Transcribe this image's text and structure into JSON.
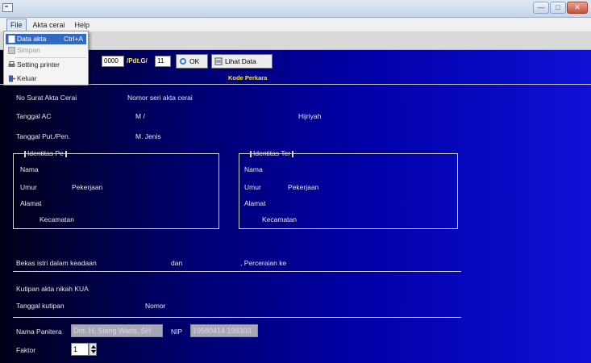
{
  "menubar": {
    "file": "File",
    "akta": "Akta cerai",
    "help": "Help"
  },
  "window_buttons": {
    "minimize": "—",
    "maximize": "□",
    "close": "✕"
  },
  "file_menu": {
    "items": [
      {
        "label": "Data akta",
        "shortcut": "Ctrl+A"
      },
      {
        "label": "Simpan",
        "shortcut": ""
      },
      {
        "label": "Setting printer",
        "shortcut": ""
      },
      {
        "label": "Keluar",
        "shortcut": ""
      }
    ]
  },
  "header": {
    "nomor_value": "0000",
    "pa_suffix": "/Pdt.G/",
    "year_value": "11",
    "ok_label": "OK",
    "lihat_label": "Lihat Data",
    "kode_perkara": "Kode Perkara"
  },
  "labels": {
    "no_surat": "No Surat Akta Cerai",
    "nomor_seri": "Nomor seri akta cerai",
    "tanggal_ac": "Tanggal AC",
    "m_slash": "M /",
    "hijriyah": "Hijriyah",
    "tanggal_put": "Tanggal Put./Pen.",
    "m_jenis": "M. Jenis",
    "identitas_pe": "Identitas Pe",
    "identitas_te": "Identitas Ter",
    "nama": "Nama",
    "umur": "Umur",
    "pekerjaan": "Pekerjaan",
    "alamat": "Alamat",
    "kecamatan": "Kecamatan",
    "bekas_istri": "Bekas istri dalam keadaan",
    "dan": "dan",
    "perceraian_ke": ", Perceraian ke",
    "kutipan": "Kutipan akta nikah KUA",
    "tanggal_kutipan": "Tanggal kutipan",
    "nomor": "Nomor",
    "nama_panitera": "Nama Panitera",
    "nip": "NIP",
    "faktor": "Faktor"
  },
  "fields": {
    "panitera_name": "Drs. H. Siang Waris, SH",
    "nip_value": "19580414 198303",
    "faktor_value": "1"
  },
  "colors": {
    "form_gradient_start": "#000018",
    "form_gradient_end": "#1010d6",
    "yellow_accent": "#ffe14a",
    "selection_blue": "#316ac5"
  }
}
